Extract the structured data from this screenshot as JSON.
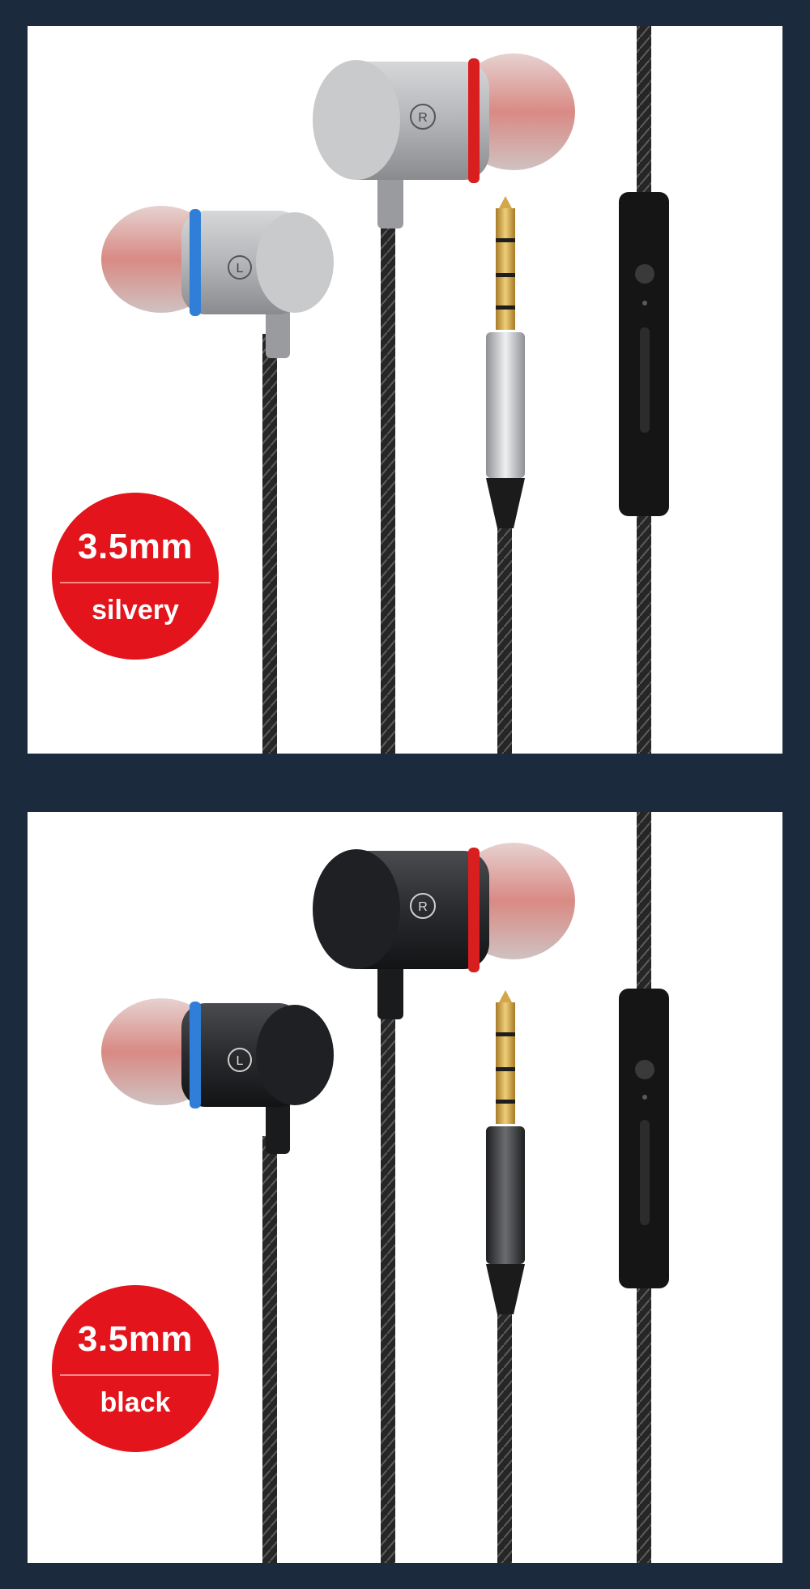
{
  "variants": [
    {
      "size_label": "3.5mm",
      "color_label": "silvery",
      "earbud_colors": {
        "body": "#b9babc",
        "body_dark": "#8c8d90",
        "face": "#c9cacc"
      }
    },
    {
      "size_label": "3.5mm",
      "color_label": "black",
      "earbud_colors": {
        "body": "#2a2b2e",
        "body_dark": "#141517",
        "face": "#1f2023"
      }
    }
  ],
  "channel_marks": {
    "left": "L",
    "right": "R"
  },
  "colors": {
    "frame": "#1c2a3e",
    "badge": "#e3141b",
    "left_ring": "#2f7fd8",
    "right_ring": "#d81e1e",
    "ear_tip": "#d9b7b4",
    "cable": "#2b2b2b",
    "plug_gold": "#d4a64a"
  }
}
